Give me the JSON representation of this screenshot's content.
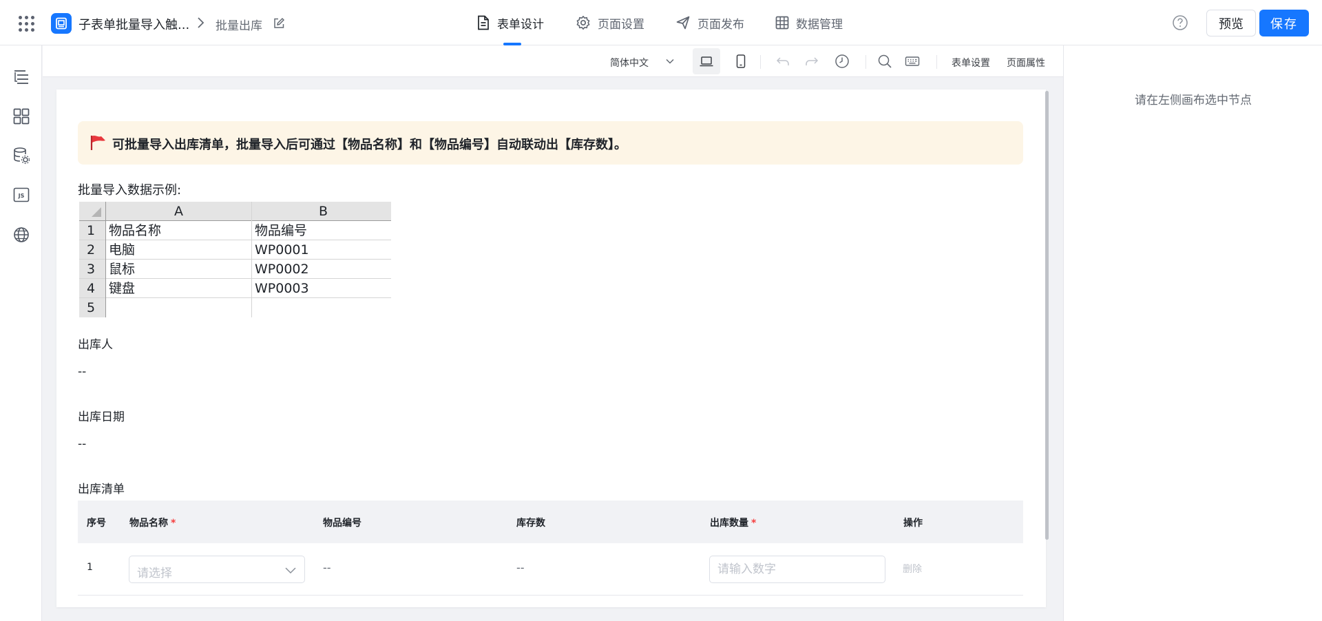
{
  "header": {
    "app_title": "子表单批量导入触...",
    "page_name": "批量出库",
    "tabs": [
      {
        "label": "表单设计",
        "icon": "document-icon"
      },
      {
        "label": "页面设置",
        "icon": "gear-icon"
      },
      {
        "label": "页面发布",
        "icon": "send-icon"
      },
      {
        "label": "数据管理",
        "icon": "grid-table-icon"
      }
    ],
    "active_tab": "表单设计",
    "preview_label": "预览",
    "save_label": "保存"
  },
  "left_rail": {
    "icons": [
      "outline-tree-icon",
      "components-grid-icon",
      "data-source-icon",
      "js-code-icon",
      "globe-icon"
    ]
  },
  "toolbar": {
    "language": "简体中文",
    "form_settings_label": "表单设置",
    "page_properties_label": "页面属性",
    "icons": [
      "desktop-view-icon",
      "mobile-view-icon",
      "undo-icon",
      "redo-icon",
      "history-icon",
      "search-icon",
      "keyboard-icon"
    ]
  },
  "canvas": {
    "notice_text": "可批量导入出库清单，批量导入后可通过【物品名称】和【物品编号】自动联动出【库存数】。",
    "example_label": "批量导入数据示例:",
    "sample_sheet": {
      "column_headers": [
        "A",
        "B"
      ],
      "row_numbers": [
        "1",
        "2",
        "3",
        "4",
        "5"
      ],
      "rows": [
        [
          "物品名称",
          "物品编号"
        ],
        [
          "电脑",
          "WP0001"
        ],
        [
          "鼠标",
          "WP0002"
        ],
        [
          "键盘",
          "WP0003"
        ],
        [
          "",
          ""
        ]
      ]
    },
    "fields": [
      {
        "label": "出库人",
        "value": "--"
      },
      {
        "label": "出库日期",
        "value": "--"
      }
    ],
    "subform": {
      "label": "出库清单",
      "columns": [
        {
          "label": "序号",
          "required": false
        },
        {
          "label": "物品名称",
          "required": true
        },
        {
          "label": "物品编号",
          "required": false
        },
        {
          "label": "库存数",
          "required": false
        },
        {
          "label": "出库数量",
          "required": true
        },
        {
          "label": "操作",
          "required": false
        }
      ],
      "required_mark": "*",
      "rows": [
        {
          "index": "1",
          "item_name_placeholder": "请选择",
          "item_code": "--",
          "stock": "--",
          "quantity_placeholder": "请输入数字",
          "action": "删除"
        }
      ]
    }
  },
  "right_panel": {
    "hint": "请在左侧画布选中节点"
  },
  "colors": {
    "primary": "#1677ff",
    "notice_bg": "#fdf5e6",
    "required": "#f53f3f",
    "flag": "#e8383d"
  }
}
